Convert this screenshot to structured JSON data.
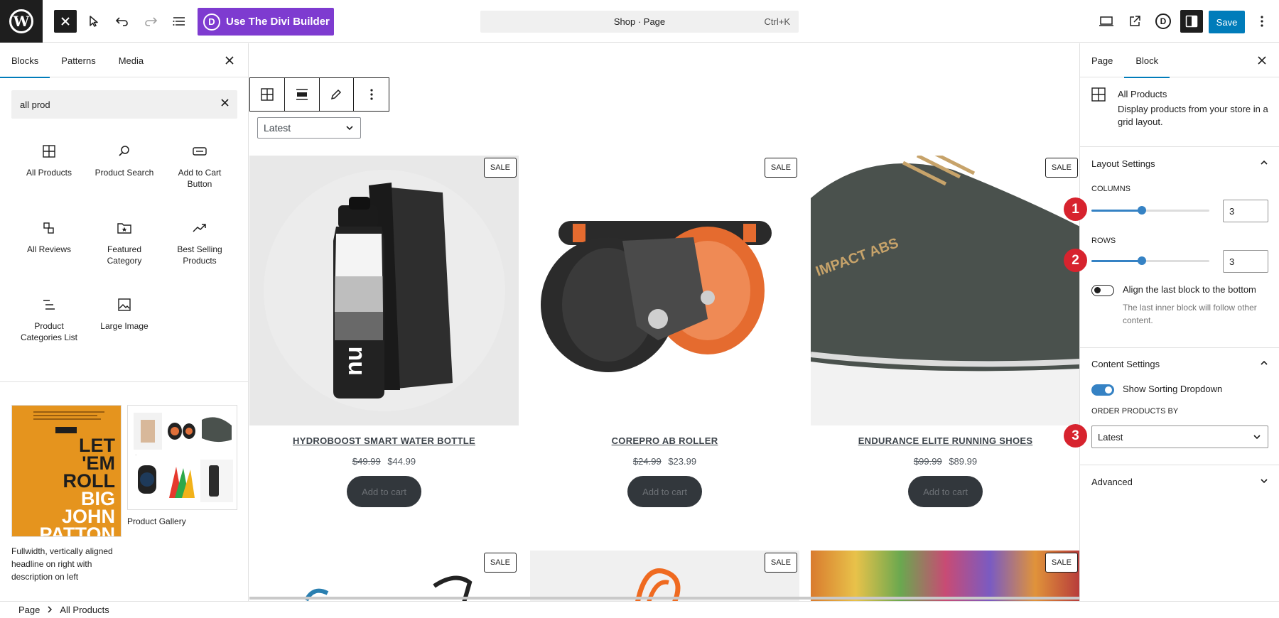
{
  "topbar": {
    "divi_label": "Use The Divi Builder",
    "divi_letter": "D",
    "command_title": "Shop · Page",
    "command_shortcut": "Ctrl+K",
    "save_label": "Save",
    "wp_letter": "W",
    "d_letter": "D"
  },
  "inserter": {
    "tabs": [
      "Blocks",
      "Patterns",
      "Media"
    ],
    "search_value": "all prod",
    "blocks": [
      {
        "label": "All Products",
        "icon": "grid-icon"
      },
      {
        "label": "Product Search",
        "icon": "search-icon"
      },
      {
        "label": "Add to Cart Button",
        "icon": "button-icon"
      },
      {
        "label": "All Reviews",
        "icon": "reviews-icon"
      },
      {
        "label": "Featured Category",
        "icon": "folder-star-icon"
      },
      {
        "label": "Best Selling Products",
        "icon": "trending-icon"
      },
      {
        "label": "Product Categories List",
        "icon": "list-icon"
      },
      {
        "label": "Large Image",
        "icon": "image-icon"
      }
    ],
    "pattern1": {
      "lines": [
        "LET",
        "'EM",
        "ROLL",
        "BIG",
        "JOHN",
        "PATTON"
      ],
      "caption": "Fullwidth, vertically aligned headline on right with description on left"
    },
    "pattern2": {
      "caption": "Product Gallery"
    }
  },
  "canvas": {
    "sort_value": "Latest",
    "sale_label": "SALE",
    "add_to_cart": "Add to cart",
    "products": [
      {
        "title": "HYDROBOOST SMART WATER BOTTLE",
        "old_price": "$49.99",
        "price": "$44.99"
      },
      {
        "title": "COREPRO AB ROLLER",
        "old_price": "$24.99",
        "price": "$23.99"
      },
      {
        "title": "ENDURANCE ELITE RUNNING SHOES",
        "old_price": "$99.99",
        "price": "$89.99"
      }
    ]
  },
  "sidebar": {
    "tabs": [
      "Page",
      "Block"
    ],
    "block_title": "All Products",
    "block_desc": "Display products from your store in a grid layout.",
    "layout": {
      "heading": "Layout Settings",
      "columns_label": "COLUMNS",
      "columns_value": "3",
      "columns_fraction": 0.43,
      "rows_label": "ROWS",
      "rows_value": "3",
      "rows_fraction": 0.43,
      "align_label": "Align the last block to the bottom",
      "align_help": "The last inner block will follow other content."
    },
    "content": {
      "heading": "Content Settings",
      "sorting_label": "Show Sorting Dropdown",
      "order_label": "ORDER PRODUCTS BY",
      "order_value": "Latest"
    },
    "advanced": "Advanced",
    "markers": [
      "1",
      "2",
      "3"
    ]
  },
  "breadcrumb": [
    "Page",
    "All Products"
  ],
  "colors": {
    "accent": "#007cba",
    "divi": "#7e3bd0",
    "marker": "#d7232e"
  }
}
